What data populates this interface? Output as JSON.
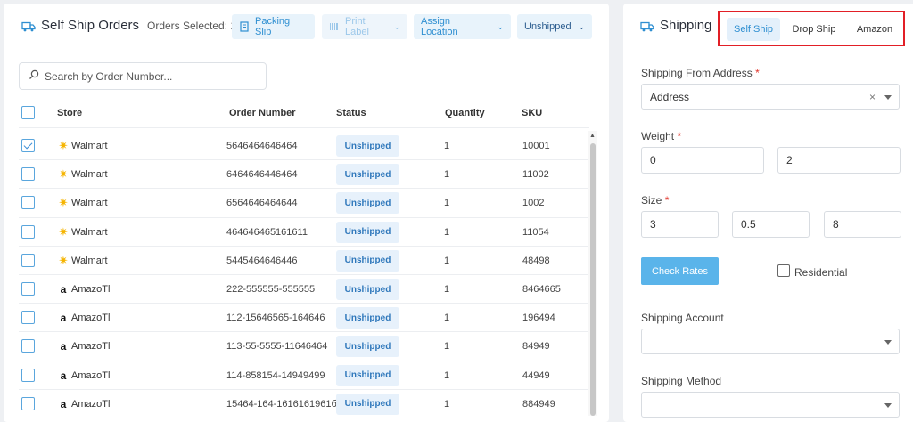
{
  "left": {
    "title": "Self Ship Orders",
    "orders_selected": "Orders Selected: 1",
    "buttons": {
      "packing_slip": "Packing Slip",
      "print_label": "Print Label",
      "assign_location": "Assign Location",
      "status_filter": "Unshipped"
    },
    "search": {
      "placeholder": "Search by Order Number..."
    },
    "columns": {
      "store": "Store",
      "order_number": "Order Number",
      "status": "Status",
      "quantity": "Quantity",
      "sku": "SKU"
    },
    "rows": [
      {
        "store": "Walmart",
        "store_icon": "walmart-spark-icon",
        "order": "5646464646464",
        "status": "Unshipped",
        "qty": "1",
        "sku": "10001",
        "checked": true
      },
      {
        "store": "Walmart",
        "store_icon": "walmart-spark-icon",
        "order": "6464646446464",
        "status": "Unshipped",
        "qty": "1",
        "sku": "11002",
        "checked": false
      },
      {
        "store": "Walmart",
        "store_icon": "walmart-spark-icon",
        "order": "6564646464644",
        "status": "Unshipped",
        "qty": "1",
        "sku": "1002",
        "checked": false
      },
      {
        "store": "Walmart",
        "store_icon": "walmart-spark-icon",
        "order": "464646465161611",
        "status": "Unshipped",
        "qty": "1",
        "sku": "11054",
        "checked": false
      },
      {
        "store": "Walmart",
        "store_icon": "walmart-spark-icon",
        "order": "5445464646446",
        "status": "Unshipped",
        "qty": "1",
        "sku": "48498",
        "checked": false
      },
      {
        "store": "AmazoTl",
        "store_icon": "amazon-a-icon",
        "order": "222-555555-555555",
        "status": "Unshipped",
        "qty": "1",
        "sku": "8464665",
        "checked": false
      },
      {
        "store": "AmazoTl",
        "store_icon": "amazon-a-icon",
        "order": "112-15646565-164646",
        "status": "Unshipped",
        "qty": "1",
        "sku": "196494",
        "checked": false
      },
      {
        "store": "AmazoTl",
        "store_icon": "amazon-a-icon",
        "order": "113-55-5555-11646464",
        "status": "Unshipped",
        "qty": "1",
        "sku": "84949",
        "checked": false
      },
      {
        "store": "AmazoTl",
        "store_icon": "amazon-a-icon",
        "order": "114-858154-14949499",
        "status": "Unshipped",
        "qty": "1",
        "sku": "44949",
        "checked": false
      },
      {
        "store": "AmazoTl",
        "store_icon": "amazon-a-icon",
        "order": "15464-164-1616161961б",
        "status": "Unshipped",
        "qty": "1",
        "sku": "884949",
        "checked": false
      }
    ]
  },
  "right": {
    "title": "Shipping",
    "tabs": [
      "Self Ship",
      "Drop Ship",
      "Amazon"
    ],
    "active_tab": "Self Ship",
    "ship_from": {
      "label": "Shipping From Address",
      "value": "Address"
    },
    "weight": {
      "label": "Weight",
      "values": [
        "0",
        "2"
      ]
    },
    "size": {
      "label": "Size",
      "values": [
        "3",
        "0.5",
        "8"
      ]
    },
    "check_rates": "Check Rates",
    "residential": "Residential",
    "shipping_account": {
      "label": "Shipping Account",
      "value": ""
    },
    "shipping_method": {
      "label": "Shipping Method"
    }
  },
  "colors": {
    "accent": "#2f8fd1",
    "primary_button": "#5ab4ea",
    "highlight_border": "#e21f26",
    "badge_bg": "#e7f1fb"
  }
}
